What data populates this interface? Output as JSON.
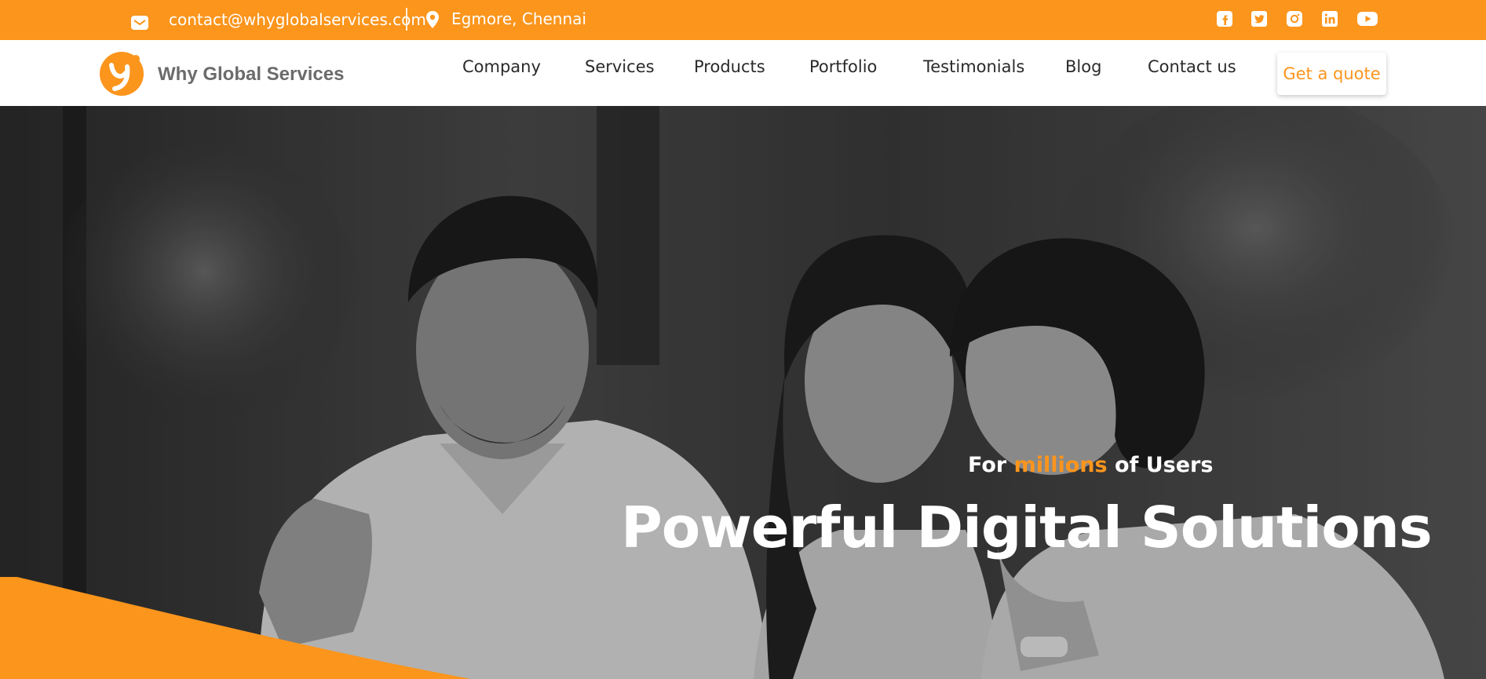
{
  "topbar": {
    "email": "contact@whyglobalservices.com",
    "location": "Egmore, Chennai",
    "social_icons": [
      "facebook-icon",
      "twitter-icon",
      "instagram-icon",
      "linkedin-icon",
      "youtube-icon"
    ]
  },
  "brand": {
    "name": "Why Global Services",
    "logo_icon": "why-global-logo"
  },
  "nav": {
    "items": [
      "Company",
      "Services",
      "Products",
      "Portfolio",
      "Testimonials",
      "Blog",
      "Contact us"
    ],
    "cta_label": "Get a quote"
  },
  "hero": {
    "kicker_before": "For",
    "kicker_accent": "millions",
    "kicker_after": "of Users",
    "title": "Powerful Digital Solutions"
  },
  "colors": {
    "accent": "#fb951c",
    "nav_text": "#2a2a2a",
    "logo_text": "#6b6b6b",
    "hero_text": "#ffffff"
  }
}
